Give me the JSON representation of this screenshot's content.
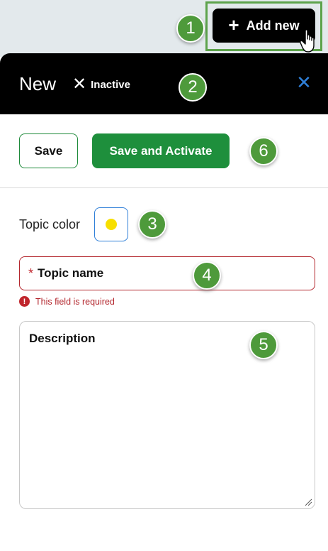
{
  "toolbar": {
    "add_new_label": "Add new"
  },
  "panel": {
    "title": "New",
    "status_label": "Inactive",
    "close_glyph": "✕"
  },
  "actions": {
    "save_label": "Save",
    "save_activate_label": "Save and Activate"
  },
  "form": {
    "topic_color_label": "Topic color",
    "topic_color_value": "#f7df00",
    "topic_name_placeholder": "Topic name",
    "required_marker": "*",
    "error_message": "This field is required",
    "error_icon_glyph": "!",
    "description_placeholder": "Description"
  },
  "callouts": [
    "1",
    "2",
    "3",
    "4",
    "5",
    "6"
  ],
  "colors": {
    "primary_green": "#1e8f3c",
    "error_red": "#b3262d",
    "accent_blue": "#2f7fd8",
    "badge_green": "#4e9a3b"
  },
  "icons": [
    "plus-icon",
    "hand-cursor-icon",
    "close-icon",
    "inactive-x-icon",
    "error-icon",
    "resize-handle-icon"
  ]
}
